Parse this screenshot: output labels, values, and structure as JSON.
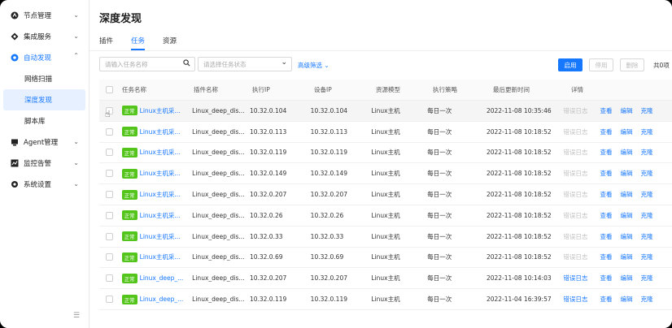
{
  "sidebar": {
    "items": [
      {
        "label": "节点管理",
        "icon": "node-icon",
        "expanded": false
      },
      {
        "label": "集成服务",
        "icon": "integration-icon",
        "expanded": false
      },
      {
        "label": "自动发现",
        "icon": "discovery-icon",
        "expanded": true,
        "children": [
          {
            "label": "网络扫描"
          },
          {
            "label": "深度发现",
            "selected": true
          },
          {
            "label": "脚本库"
          }
        ]
      },
      {
        "label": "Agent管理",
        "icon": "agent-icon",
        "expanded": false
      },
      {
        "label": "监控告警",
        "icon": "monitor-icon",
        "expanded": false
      },
      {
        "label": "系统设置",
        "icon": "settings-icon",
        "expanded": false
      }
    ]
  },
  "page": {
    "title": "深度发现",
    "tabs": [
      "插件",
      "任务",
      "资源"
    ],
    "active_tab": "任务"
  },
  "filters": {
    "name_placeholder": "请输入任务名称",
    "status_placeholder": "请选择任务状态",
    "advanced": "高级筛选"
  },
  "actions": {
    "enable": "启用",
    "disable": "停用",
    "delete": "删除",
    "total": "共0项"
  },
  "table": {
    "headers": [
      "任务名称",
      "插件名称",
      "执行IP",
      "设备IP",
      "资源模型",
      "执行策略",
      "最后更新时间",
      "详情"
    ],
    "status_badge": "正常",
    "error_log": "错误日志",
    "ops": [
      "查看",
      "编辑",
      "克隆"
    ],
    "rows": [
      {
        "name": "Linux主机采...",
        "plugin": "Linux_deep_dis...",
        "exec_ip": "10.32.0.104",
        "dev_ip": "10.32.0.104",
        "model": "Linux主机",
        "policy": "每日一次",
        "time": "2022-11-08 10:35:46",
        "log_active": false
      },
      {
        "name": "Linux主机采...",
        "plugin": "Linux_deep_dis...",
        "exec_ip": "10.32.0.113",
        "dev_ip": "10.32.0.113",
        "model": "Linux主机",
        "policy": "每日一次",
        "time": "2022-11-08 10:18:52",
        "log_active": false
      },
      {
        "name": "Linux主机采...",
        "plugin": "Linux_deep_dis...",
        "exec_ip": "10.32.0.119",
        "dev_ip": "10.32.0.119",
        "model": "Linux主机",
        "policy": "每日一次",
        "time": "2022-11-08 10:18:52",
        "log_active": false
      },
      {
        "name": "Linux主机采...",
        "plugin": "Linux_deep_dis...",
        "exec_ip": "10.32.0.149",
        "dev_ip": "10.32.0.149",
        "model": "Linux主机",
        "policy": "每日一次",
        "time": "2022-11-08 10:18:52",
        "log_active": false
      },
      {
        "name": "Linux主机采...",
        "plugin": "Linux_deep_dis...",
        "exec_ip": "10.32.0.207",
        "dev_ip": "10.32.0.207",
        "model": "Linux主机",
        "policy": "每日一次",
        "time": "2022-11-08 10:18:52",
        "log_active": false
      },
      {
        "name": "Linux主机采...",
        "plugin": "Linux_deep_dis...",
        "exec_ip": "10.32.0.26",
        "dev_ip": "10.32.0.26",
        "model": "Linux主机",
        "policy": "每日一次",
        "time": "2022-11-08 10:18:52",
        "log_active": false
      },
      {
        "name": "Linux主机采...",
        "plugin": "Linux_deep_dis...",
        "exec_ip": "10.32.0.33",
        "dev_ip": "10.32.0.33",
        "model": "Linux主机",
        "policy": "每日一次",
        "time": "2022-11-08 10:18:52",
        "log_active": false
      },
      {
        "name": "Linux主机采...",
        "plugin": "Linux_deep_dis...",
        "exec_ip": "10.32.0.69",
        "dev_ip": "10.32.0.69",
        "model": "Linux主机",
        "policy": "每日一次",
        "time": "2022-11-08 10:18:52",
        "log_active": false
      },
      {
        "name": "Linux_deep_...",
        "plugin": "Linux_deep_dis...",
        "exec_ip": "10.32.0.207",
        "dev_ip": "10.32.0.207",
        "model": "Linux主机",
        "policy": "每日一次",
        "time": "2022-11-08 10:14:03",
        "log_active": true
      },
      {
        "name": "Linux_deep_...",
        "plugin": "Linux_deep_dis...",
        "exec_ip": "10.32.0.119",
        "dev_ip": "10.32.0.119",
        "model": "Linux主机",
        "policy": "每日一次",
        "time": "2022-11-04 16:39:57",
        "log_active": true
      }
    ]
  },
  "colors": {
    "accent": "#1677ff",
    "success": "#52c41a"
  }
}
